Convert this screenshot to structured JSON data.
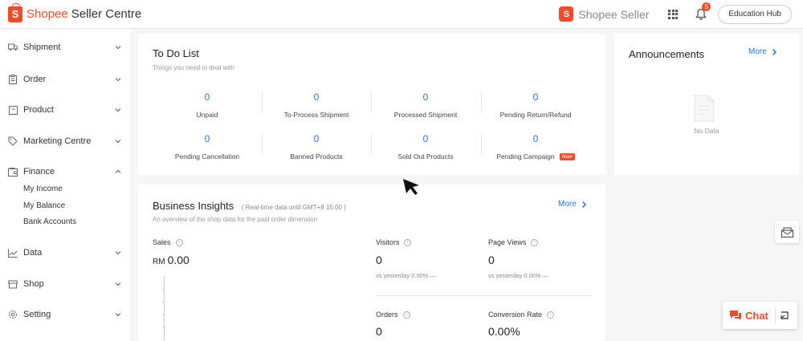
{
  "header": {
    "brand_logo_letter": "S",
    "brand_name": "Shopee",
    "brand_sub": "Seller Centre",
    "seller_logo_letter": "S",
    "seller_logo_text": "Shopee Seller",
    "notification_count": "5",
    "education_hub_label": "Education Hub"
  },
  "sidebar": {
    "items": [
      {
        "label": "Shipment",
        "icon": "truck-icon"
      },
      {
        "label": "Order",
        "icon": "clipboard-icon"
      },
      {
        "label": "Product",
        "icon": "box-icon"
      },
      {
        "label": "Marketing Centre",
        "icon": "tag-icon"
      },
      {
        "label": "Finance",
        "icon": "wallet-icon",
        "expanded": true,
        "children": [
          "My Income",
          "My Balance",
          "Bank Accounts"
        ]
      },
      {
        "label": "Data",
        "icon": "chart-icon"
      },
      {
        "label": "Shop",
        "icon": "store-icon"
      },
      {
        "label": "Setting",
        "icon": "gear-icon"
      }
    ]
  },
  "todo": {
    "title": "To Do List",
    "desc": "Things you need to deal with",
    "items": [
      {
        "count": "0",
        "label": "Unpaid"
      },
      {
        "count": "0",
        "label": "To-Process Shipment"
      },
      {
        "count": "0",
        "label": "Processed Shipment"
      },
      {
        "count": "0",
        "label": "Pending Return/Refund"
      },
      {
        "count": "0",
        "label": "Pending Cancellation"
      },
      {
        "count": "0",
        "label": "Banned Products"
      },
      {
        "count": "0",
        "label": "Sold Out Products"
      },
      {
        "count": "0",
        "label": "Pending Campaign",
        "tag": "New"
      }
    ]
  },
  "announcements": {
    "title": "Announcements",
    "more_label": "More",
    "empty_text": "No Data"
  },
  "insights": {
    "title": "Business Insights",
    "subtitle": "( Real-time data until GMT+8 15:00 )",
    "desc": "An overview of the shop data for the paid order dimension",
    "more_label": "More",
    "sales": {
      "label": "Sales",
      "currency": "RM",
      "value": "0.00"
    },
    "visitors": {
      "label": "Visitors",
      "value": "0",
      "sub": "vs yesterday 0.00% —"
    },
    "page_views": {
      "label": "Page Views",
      "value": "0",
      "sub": "vs yesterday 0.00% —"
    },
    "orders": {
      "label": "Orders",
      "value": "0"
    },
    "conversion": {
      "label": "Conversion Rate",
      "value": "0.00%"
    }
  },
  "chat": {
    "label": "Chat"
  },
  "colors": {
    "brand": "#ee4d2d",
    "link": "#2673dd"
  }
}
